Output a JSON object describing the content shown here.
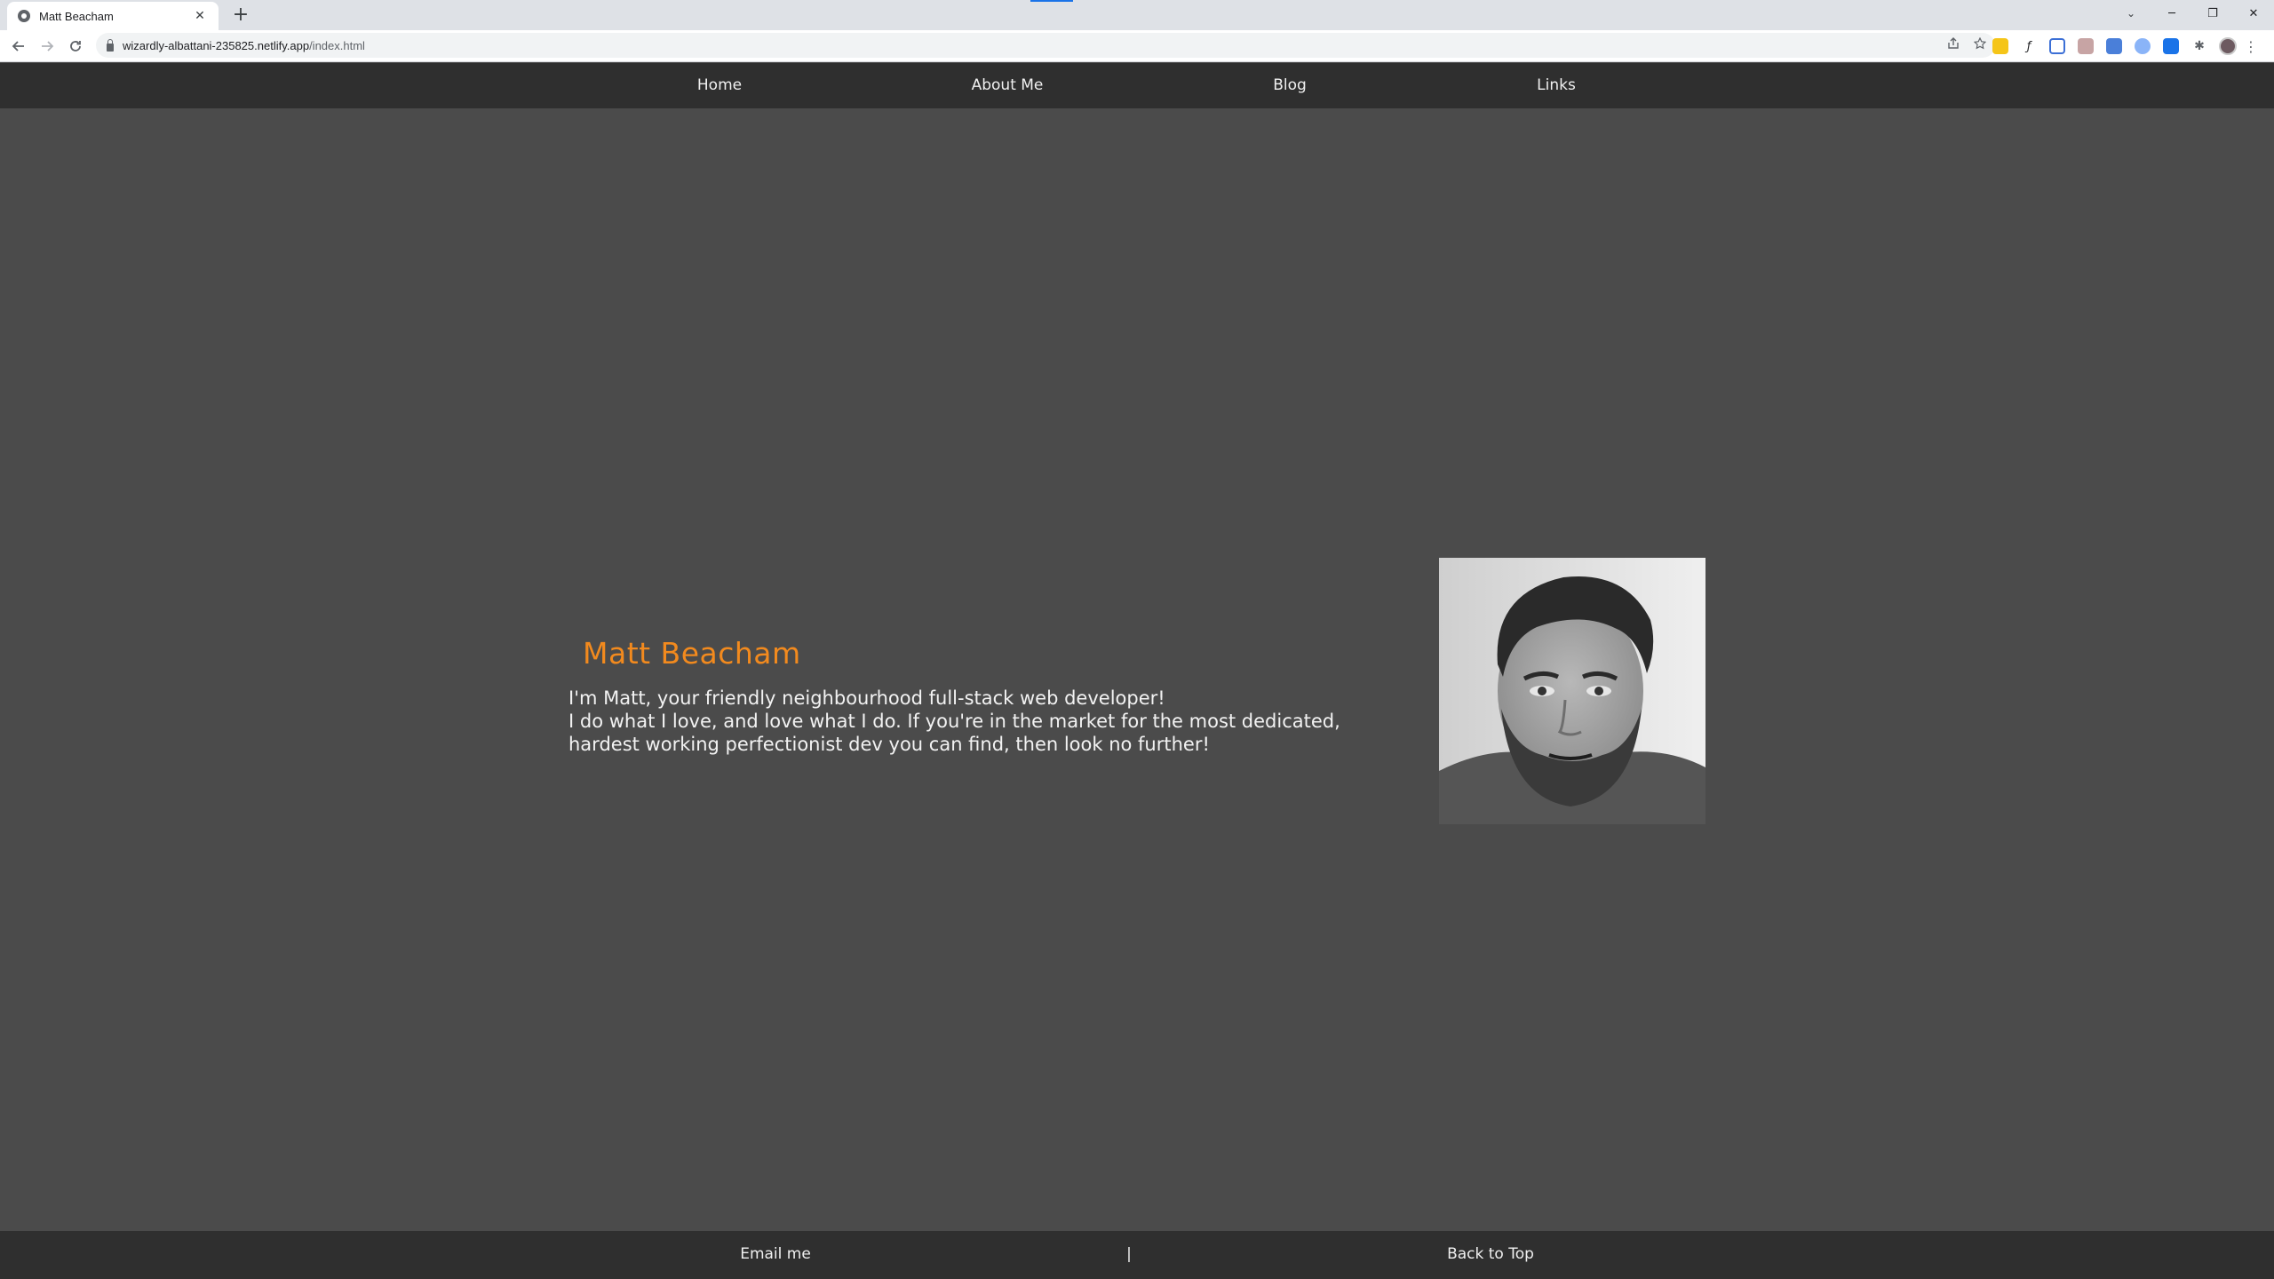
{
  "browser": {
    "tab_title": "Matt Beacham",
    "tab_close": "✕",
    "new_tab": "+",
    "url_host": "wizardly-albattani-235825.netlify.app",
    "url_path": "/index.html",
    "window_controls": {
      "minimize": "─",
      "restore": "❐",
      "close": "✕"
    },
    "tab_search": "⌄"
  },
  "nav": {
    "items": [
      {
        "label": "Home"
      },
      {
        "label": "About Me"
      },
      {
        "label": "Blog"
      },
      {
        "label": "Links"
      }
    ]
  },
  "hero": {
    "name": "Matt Beacham",
    "bio_line_1": "I'm Matt, your friendly neighbourhood full-stack web developer!",
    "bio_line_2": "I do what I love, and love what I do. If you're in the market for the most dedicated, hardest working perfectionist dev you can find, then look no further!"
  },
  "footer": {
    "email_label": "Email me",
    "separator": "|",
    "back_to_top_label": "Back to Top"
  },
  "colors": {
    "accent": "#f28a1e",
    "page_bg": "#4b4b4b",
    "bar_bg": "#2f2f2f",
    "text": "#f0f0f0"
  }
}
